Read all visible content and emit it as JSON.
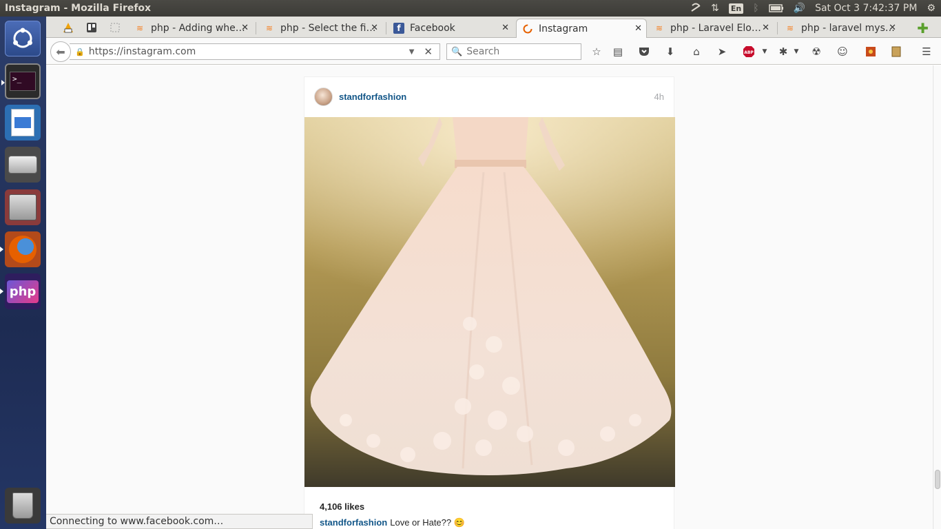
{
  "panel": {
    "title": "Instagram - Mozilla Firefox",
    "lang": "En",
    "clock": "Sat Oct  3  7:42:37 PM"
  },
  "tabs": [
    {
      "label": "php - Adding whe…",
      "icon": "stackoverflow-icon"
    },
    {
      "label": "php - Select the fi…",
      "icon": "stackoverflow-icon"
    },
    {
      "label": "Facebook",
      "icon": "facebook-icon"
    },
    {
      "label": "Instagram",
      "icon": "instagram-icon",
      "selected": true
    },
    {
      "label": "php - Laravel Elo…",
      "icon": "stackoverflow-icon"
    },
    {
      "label": "php - laravel mys…",
      "icon": "stackoverflow-icon"
    }
  ],
  "navbar": {
    "url": "https://instagram.com",
    "search_placeholder": "Search"
  },
  "post": {
    "username": "standforfashion",
    "time_ago": "4h",
    "likes": "4,106 likes",
    "caption_user": "standforfashion",
    "caption_text": "Love or Hate?? 😊"
  },
  "status": "Connecting to www.facebook.com…",
  "colors": {
    "ig_link": "#125688",
    "launcher_bg": "#2c3e6b",
    "panel_bg": "#3c3b37"
  }
}
